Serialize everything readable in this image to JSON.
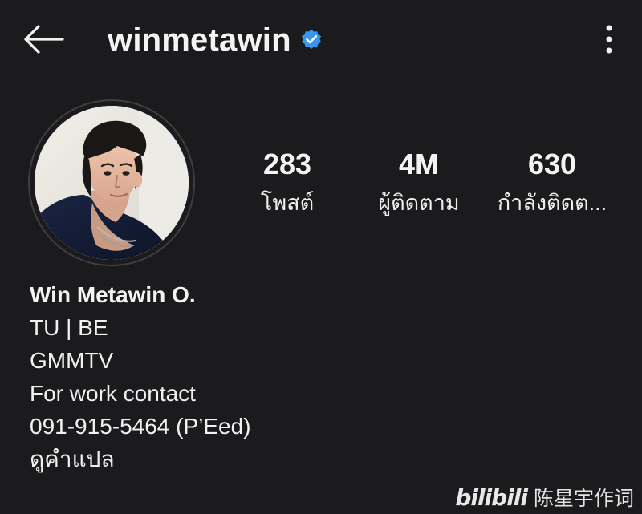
{
  "header": {
    "back_icon": "back-arrow-icon",
    "username": "winmetawin",
    "verified_icon": "verified-badge-icon",
    "verified_color": "#3797F0",
    "more_icon": "more-vertical-icon"
  },
  "profile": {
    "avatar_icon": "profile-photo"
  },
  "stats": [
    {
      "value": "283",
      "label": "โพสต์"
    },
    {
      "value": "4M",
      "label": "ผู้ติดตาม"
    },
    {
      "value": "630",
      "label": "กำลังติดต..."
    }
  ],
  "bio": {
    "name": "Win Metawin O.",
    "lines": [
      "TU | BE",
      "GMMTV",
      "For work contact",
      "091-915-5464 (P’Eed)"
    ],
    "translate": "ดูคำแปล"
  },
  "watermark": {
    "logo": "bilibili",
    "text": "陈星宇作词"
  },
  "colors": {
    "background": "#1B1B1D",
    "text": "#F4F4F4",
    "avatar_ring": "#3F3F3F"
  }
}
